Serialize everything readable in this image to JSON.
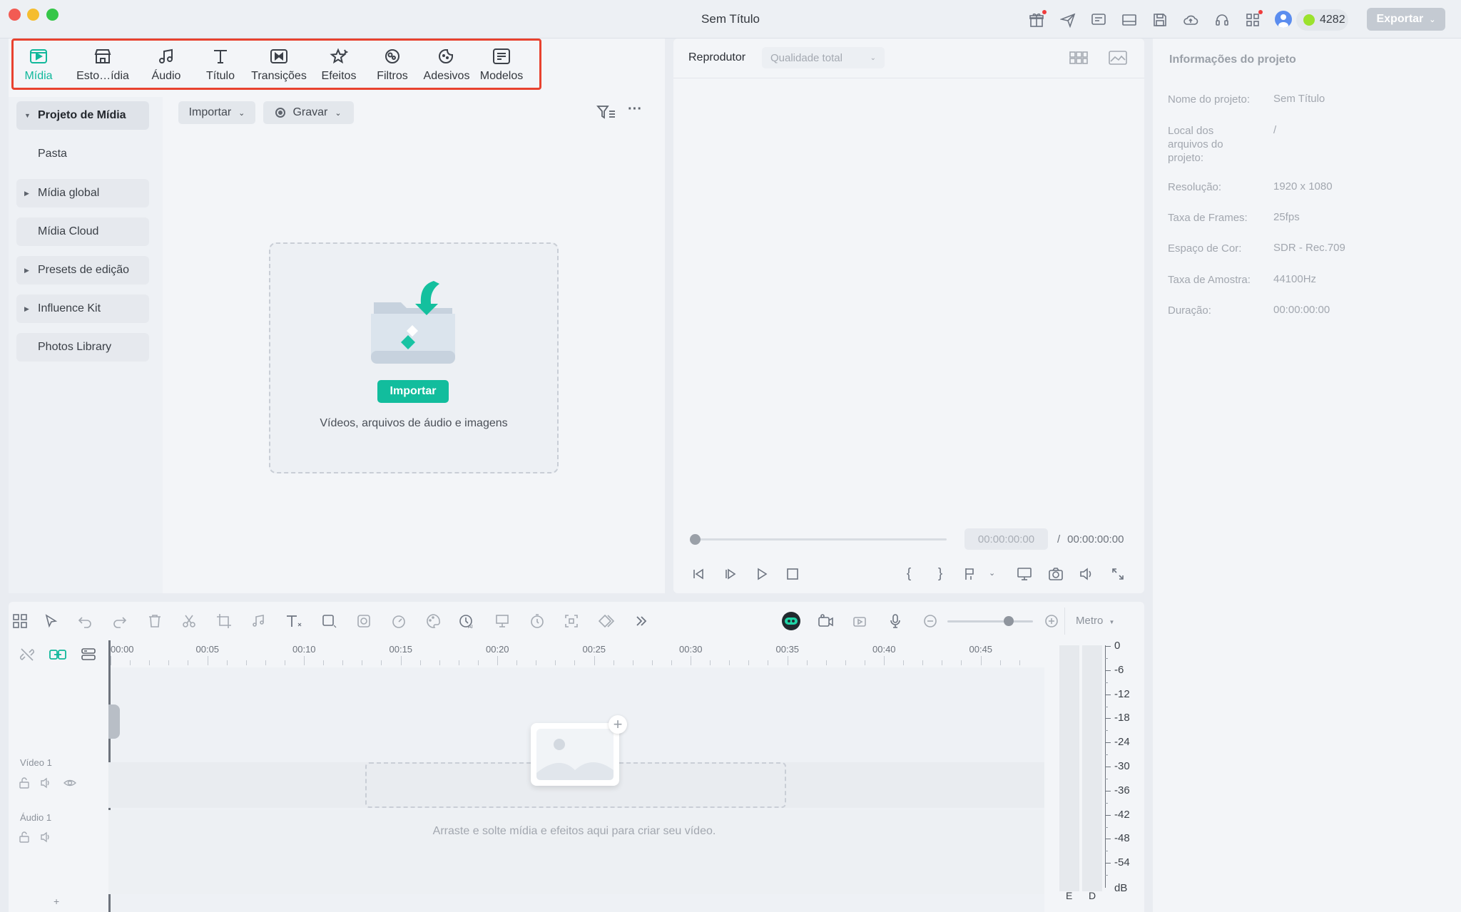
{
  "window": {
    "title": "Sem Título"
  },
  "header": {
    "credits": "4282",
    "export_label": "Exportar"
  },
  "tabs": [
    {
      "label": "Mídia",
      "icon": "media-icon",
      "active": true
    },
    {
      "label": "Esto…ídia",
      "icon": "store-icon"
    },
    {
      "label": "Áudio",
      "icon": "music-note-icon"
    },
    {
      "label": "Título",
      "icon": "title-t-icon"
    },
    {
      "label": "Transições",
      "icon": "transition-icon"
    },
    {
      "label": "Efeitos",
      "icon": "effects-icon"
    },
    {
      "label": "Filtros",
      "icon": "filter-icon"
    },
    {
      "label": "Adesivos",
      "icon": "sticker-icon"
    },
    {
      "label": "Modelos",
      "icon": "template-icon"
    }
  ],
  "sidebar": {
    "items": [
      {
        "label": "Projeto de Mídia",
        "caret": true,
        "active": true
      },
      {
        "label": "Pasta"
      },
      {
        "label": "Mídia global",
        "caret": true
      },
      {
        "label": "Mídia Cloud"
      },
      {
        "label": "Presets de edição",
        "caret": true
      },
      {
        "label": "Influence Kit",
        "caret": true
      },
      {
        "label": "Photos Library"
      }
    ]
  },
  "media": {
    "import_label": "Importar",
    "record_label": "Gravar",
    "drop_button": "Importar",
    "drop_caption": "Vídeos, arquivos de áudio e imagens"
  },
  "player": {
    "title": "Reprodutor",
    "quality": "Qualidade total",
    "current_time": "00:00:00:00",
    "separator": "/",
    "total_time": "00:00:00:00"
  },
  "info": {
    "heading": "Informações do projeto",
    "rows": [
      {
        "label": "Nome do projeto:",
        "value": "Sem Título"
      },
      {
        "label": "Local dos arquivos do projeto:",
        "value": "/"
      },
      {
        "label": "Resolução:",
        "value": "1920 x 1080"
      },
      {
        "label": "Taxa de Frames:",
        "value": "25fps"
      },
      {
        "label": "Espaço de Cor:",
        "value": "SDR - Rec.709"
      },
      {
        "label": "Taxa de Amostra:",
        "value": "44100Hz"
      },
      {
        "label": "Duração:",
        "value": "00:00:00:00"
      }
    ]
  },
  "timeline": {
    "ruler": [
      "00:00",
      "00:05",
      "00:10",
      "00:15",
      "00:20",
      "00:25",
      "00:30",
      "00:35",
      "00:40",
      "00:45"
    ],
    "zoom_mode": "Metro",
    "tracks": [
      {
        "label": "Vídeo 1"
      },
      {
        "label": "Áudio 1"
      }
    ],
    "drop_caption": "Arraste e solte mídia e efeitos aqui para criar seu vídeo.",
    "zoom_level": 0.72
  },
  "meter": {
    "scale": [
      "0",
      "-6",
      "-12",
      "-18",
      "-24",
      "-30",
      "-36",
      "-42",
      "-48",
      "-54"
    ],
    "unit": "dB",
    "left": "E",
    "right": "D"
  },
  "colors": {
    "accent": "#11b89b",
    "highlight": "#e8422f",
    "export_bg": "#c4cad2"
  }
}
